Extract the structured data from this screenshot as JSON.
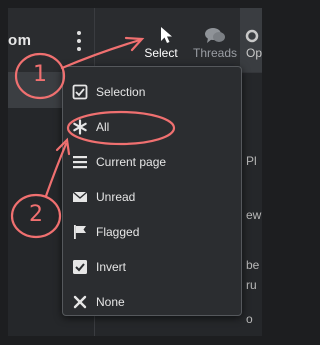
{
  "header": {
    "title": "om"
  },
  "toolbar": {
    "select_label": "Select",
    "threads_label": "Threads",
    "op_label": "Op"
  },
  "background_text": [
    "Pl",
    "ew",
    "be",
    "ru",
    "o"
  ],
  "menu": {
    "items": [
      {
        "label": "Selection",
        "icon": "checkbox-icon"
      },
      {
        "label": "All",
        "icon": "asterisk-icon"
      },
      {
        "label": "Current page",
        "icon": "lines-icon"
      },
      {
        "label": "Unread",
        "icon": "envelope-icon"
      },
      {
        "label": "Flagged",
        "icon": "flag-icon"
      },
      {
        "label": "Invert",
        "icon": "checked-box-icon"
      },
      {
        "label": "None",
        "icon": "x-icon"
      }
    ]
  },
  "annotations": {
    "step1": "1",
    "step2": "2",
    "color": "#f07070"
  }
}
